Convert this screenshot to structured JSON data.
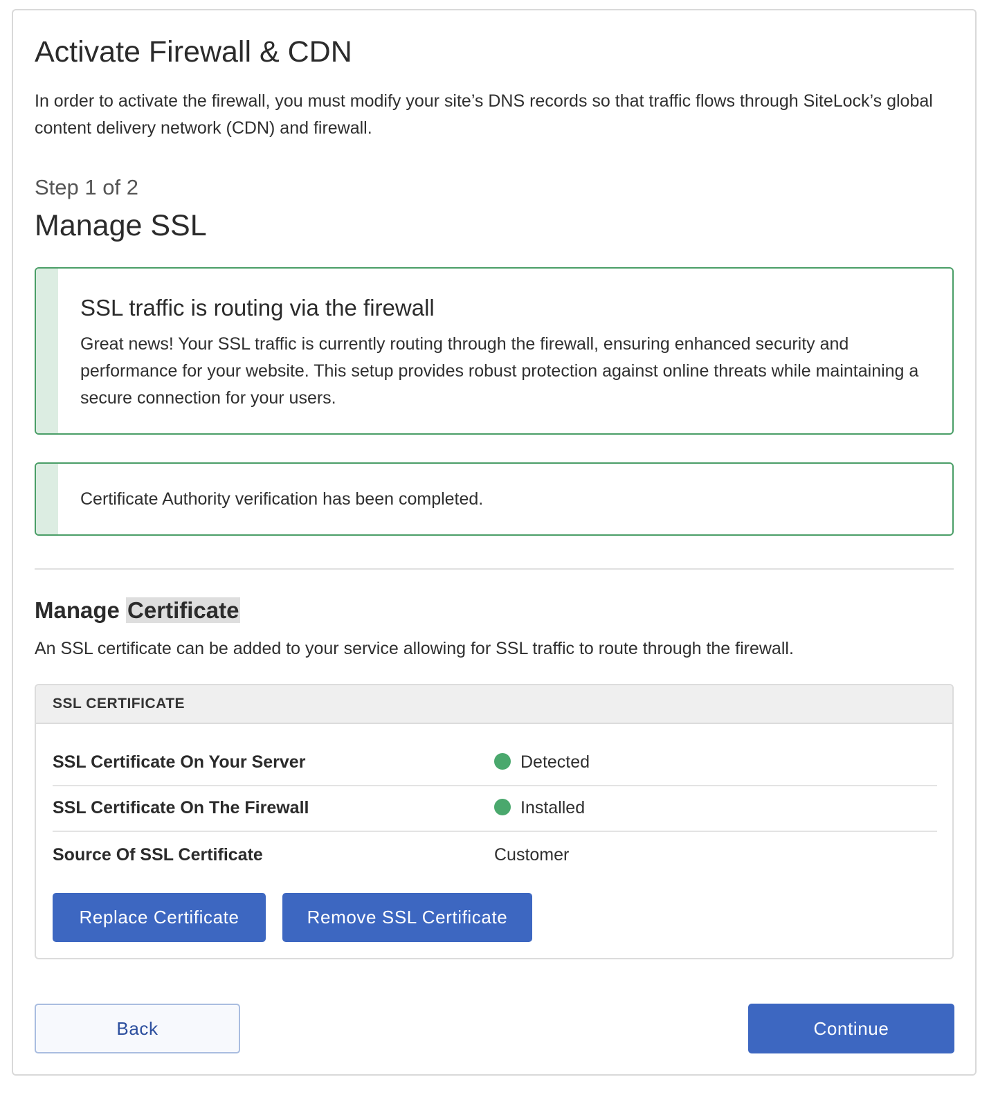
{
  "header": {
    "title": "Activate Firewall & CDN",
    "intro": "In order to activate the firewall, you must modify your site’s DNS records so that traffic flows through SiteLock’s global content delivery network (CDN) and firewall."
  },
  "step": {
    "label": "Step 1 of 2",
    "title": "Manage SSL"
  },
  "alerts": [
    {
      "title": "SSL traffic is routing via the firewall",
      "body": "Great news! Your SSL traffic is currently routing through the firewall, ensuring enhanced security and performance for your website. This setup provides robust protection against online threats while maintaining a secure connection for your users.",
      "status_color": "#4a9e67"
    },
    {
      "body": "Certificate Authority verification has been completed.",
      "status_color": "#4a9e67"
    }
  ],
  "certificate_section": {
    "title_part1": "Manage",
    "title_part2": "Certificate",
    "description": "An SSL certificate can be added to your service allowing for SSL traffic to route through the firewall."
  },
  "ssl_panel": {
    "header": "SSL CERTIFICATE",
    "rows": [
      {
        "label": "SSL Certificate On Your Server",
        "value": "Detected",
        "status_dot": "green",
        "dot_color": "#4aa86d"
      },
      {
        "label": "SSL Certificate On The Firewall",
        "value": "Installed",
        "status_dot": "green",
        "dot_color": "#4aa86d"
      },
      {
        "label": "Source Of SSL Certificate",
        "value": "Customer"
      }
    ],
    "buttons": {
      "replace": "Replace Certificate",
      "remove": "Remove SSL Certificate"
    }
  },
  "footer": {
    "back_label": "Back",
    "continue_label": "Continue"
  },
  "colors": {
    "primary_button": "#3d67c1",
    "success_border": "#4a9e67",
    "success_stripe": "#dcede2"
  }
}
